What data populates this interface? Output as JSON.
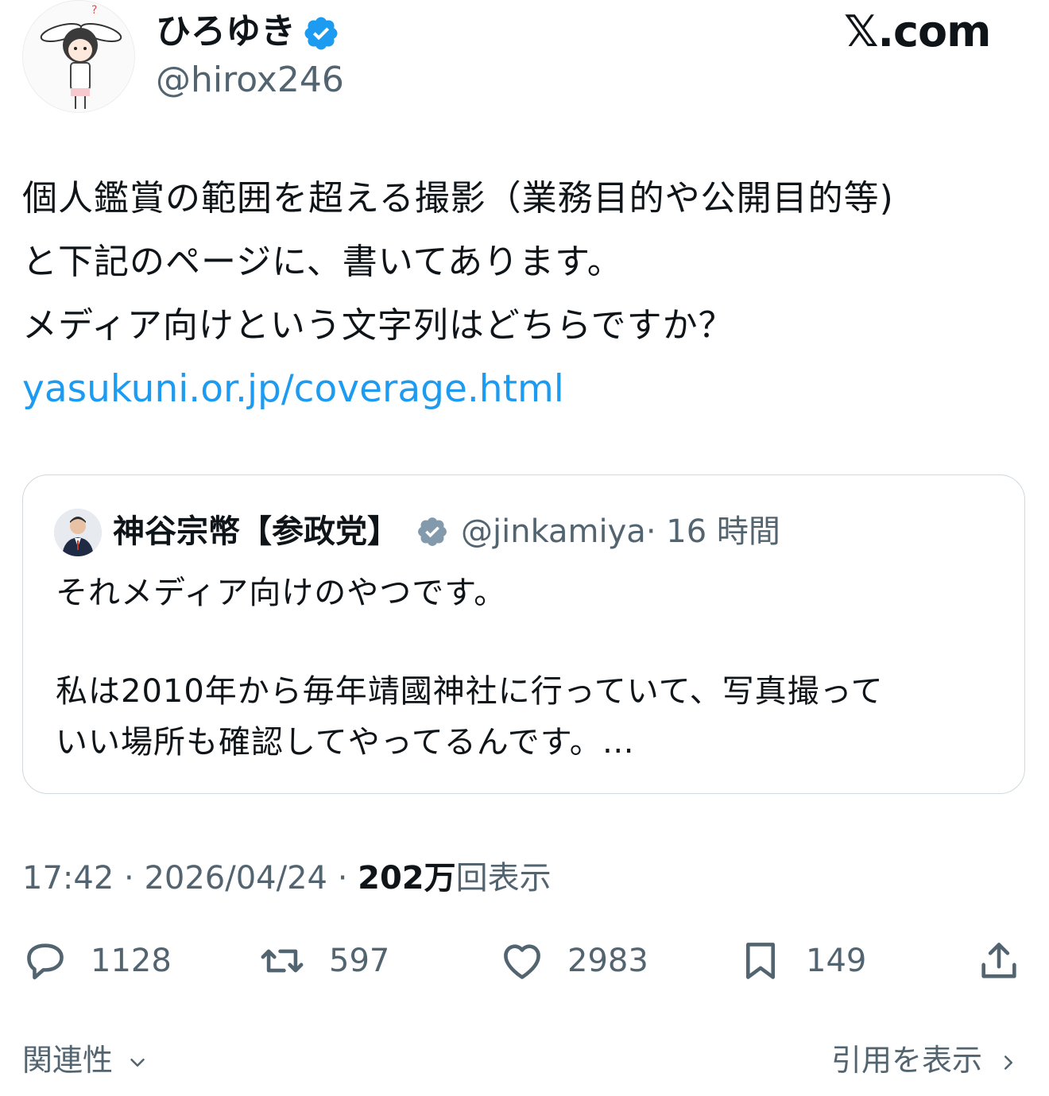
{
  "author": {
    "display_name": "ひろゆき",
    "handle": "@hirox246",
    "verified": true
  },
  "brand": "𝕏.com",
  "tweet": {
    "lines": [
      "個人鑑賞の範囲を超える撮影（業務目的や公開目的等)",
      "と下記のページに、書いてあります。",
      "メディア向けという文字列はどちらですか？"
    ],
    "link": "yasukuni.or.jp/coverage.html"
  },
  "quoted": {
    "display_name": "神谷宗幣【参政党】",
    "handle": "@jinkamiya",
    "time": "· 16 時間",
    "line1": "それメディア向けのやつです。",
    "line2": "私は2010年から毎年靖國神社に行っていて、写真撮って",
    "line3": "いい場所も確認してやってるんです。…"
  },
  "meta": {
    "time": "17:42",
    "sep1": " · ",
    "date": "2026/04/24",
    "sep2": " · ",
    "views_count": "202万",
    "views_label": "回表示"
  },
  "actions": {
    "replies": "1128",
    "reposts": "597",
    "likes": "2983",
    "bookmarks": "149"
  },
  "footer": {
    "relevance": "関連性",
    "view_quotes": "引用を表示"
  },
  "colors": {
    "link": "#1d9bf0",
    "secondary_text": "#536471",
    "border": "#cfd9de"
  },
  "icons": [
    "verified-badge-icon",
    "reply-icon",
    "repost-icon",
    "like-icon",
    "bookmark-icon",
    "share-icon",
    "chevron-down-icon",
    "chevron-right-icon"
  ]
}
